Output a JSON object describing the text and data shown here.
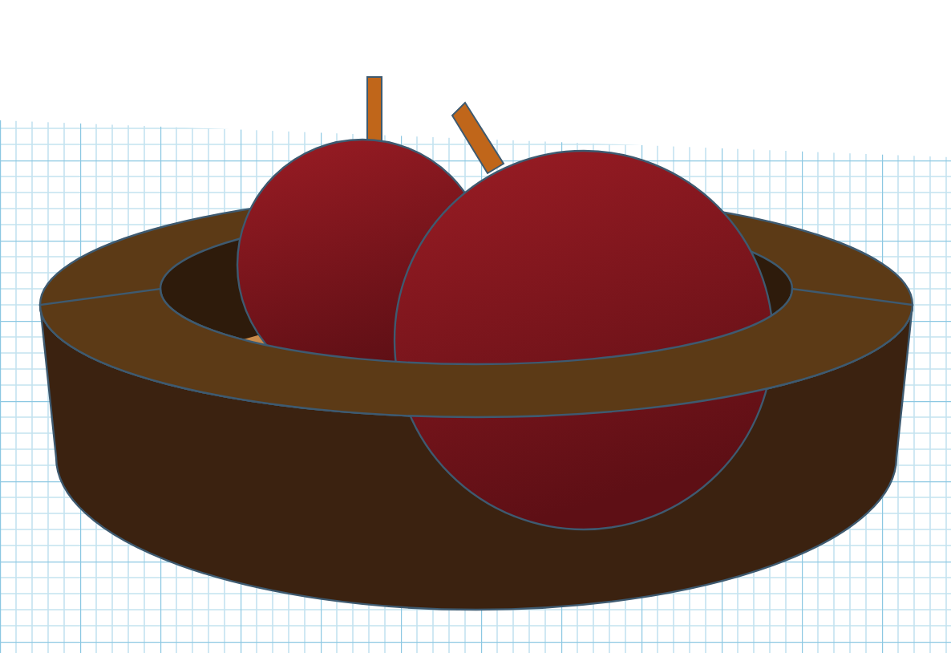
{
  "scene": {
    "kind": "bowl-with-apples"
  }
}
